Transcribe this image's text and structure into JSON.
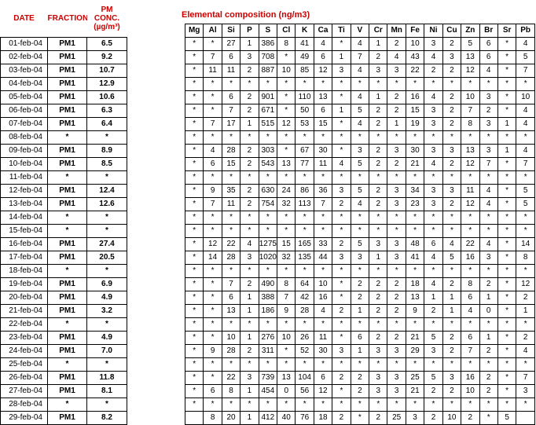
{
  "headers": {
    "date": "DATE",
    "fraction": "FRACTION",
    "pm_conc_line1": "PM",
    "pm_conc_line2": "CONC.",
    "pm_conc_unit": "(µg/m³)",
    "composition_title": "Elemental composition (ng/m3)"
  },
  "elements": [
    "Mg",
    "Al",
    "Si",
    "P",
    "S",
    "Cl",
    "K",
    "Ca",
    "Ti",
    "V",
    "Cr",
    "Mn",
    "Fe",
    "Ni",
    "Cu",
    "Zn",
    "Br",
    "Sr",
    "Pb"
  ],
  "rows": [
    {
      "date": "01-feb-04",
      "fraction": "PM1",
      "conc": "6.5",
      "values": [
        "*",
        "*",
        "27",
        "1",
        "386",
        "8",
        "41",
        "4",
        "*",
        "4",
        "1",
        "2",
        "10",
        "3",
        "2",
        "5",
        "6",
        "*",
        "4"
      ]
    },
    {
      "date": "02-feb-04",
      "fraction": "PM1",
      "conc": "9.2",
      "values": [
        "*",
        "7",
        "6",
        "3",
        "708",
        "*",
        "49",
        "6",
        "1",
        "7",
        "2",
        "4",
        "43",
        "4",
        "3",
        "13",
        "6",
        "*",
        "5"
      ]
    },
    {
      "date": "03-feb-04",
      "fraction": "PM1",
      "conc": "10.7",
      "values": [
        "*",
        "11",
        "11",
        "2",
        "887",
        "10",
        "85",
        "12",
        "3",
        "4",
        "3",
        "3",
        "22",
        "2",
        "2",
        "12",
        "4",
        "*",
        "7"
      ]
    },
    {
      "date": "04-feb-04",
      "fraction": "PM1",
      "conc": "12.9",
      "values": [
        "*",
        "*",
        "*",
        "*",
        "*",
        "*",
        "*",
        "*",
        "*",
        "*",
        "*",
        "*",
        "*",
        "*",
        "*",
        "*",
        "*",
        "*",
        "*"
      ]
    },
    {
      "date": "05-feb-04",
      "fraction": "PM1",
      "conc": "10.6",
      "values": [
        "*",
        "*",
        "6",
        "2",
        "901",
        "*",
        "110",
        "13",
        "*",
        "4",
        "1",
        "2",
        "16",
        "4",
        "2",
        "10",
        "3",
        "*",
        "10"
      ]
    },
    {
      "date": "06-feb-04",
      "fraction": "PM1",
      "conc": "6.3",
      "values": [
        "*",
        "*",
        "7",
        "2",
        "671",
        "*",
        "50",
        "6",
        "1",
        "5",
        "2",
        "2",
        "15",
        "3",
        "2",
        "7",
        "2",
        "*",
        "4"
      ]
    },
    {
      "date": "07-feb-04",
      "fraction": "PM1",
      "conc": "6.4",
      "values": [
        "*",
        "7",
        "17",
        "1",
        "515",
        "12",
        "53",
        "15",
        "*",
        "4",
        "2",
        "1",
        "19",
        "3",
        "2",
        "8",
        "3",
        "1",
        "4"
      ]
    },
    {
      "date": "08-feb-04",
      "fraction": "*",
      "conc": "*",
      "values": [
        "*",
        "*",
        "*",
        "*",
        "*",
        "*",
        "*",
        "*",
        "*",
        "*",
        "*",
        "*",
        "*",
        "*",
        "*",
        "*",
        "*",
        "*",
        "*"
      ]
    },
    {
      "date": "09-feb-04",
      "fraction": "PM1",
      "conc": "8.9",
      "values": [
        "*",
        "4",
        "28",
        "2",
        "303",
        "*",
        "67",
        "30",
        "*",
        "3",
        "2",
        "3",
        "30",
        "3",
        "3",
        "13",
        "3",
        "1",
        "4"
      ]
    },
    {
      "date": "10-feb-04",
      "fraction": "PM1",
      "conc": "8.5",
      "values": [
        "*",
        "6",
        "15",
        "2",
        "543",
        "13",
        "77",
        "11",
        "4",
        "5",
        "2",
        "2",
        "21",
        "4",
        "2",
        "12",
        "7",
        "*",
        "7"
      ]
    },
    {
      "date": "11-feb-04",
      "fraction": "*",
      "conc": "*",
      "values": [
        "*",
        "*",
        "*",
        "*",
        "*",
        "*",
        "*",
        "*",
        "*",
        "*",
        "*",
        "*",
        "*",
        "*",
        "*",
        "*",
        "*",
        "*",
        "*"
      ]
    },
    {
      "date": "12-feb-04",
      "fraction": "PM1",
      "conc": "12.4",
      "values": [
        "*",
        "9",
        "35",
        "2",
        "630",
        "24",
        "86",
        "36",
        "3",
        "5",
        "2",
        "3",
        "34",
        "3",
        "3",
        "11",
        "4",
        "*",
        "5"
      ]
    },
    {
      "date": "13-feb-04",
      "fraction": "PM1",
      "conc": "12.6",
      "values": [
        "*",
        "7",
        "11",
        "2",
        "754",
        "32",
        "113",
        "7",
        "2",
        "4",
        "2",
        "3",
        "23",
        "3",
        "2",
        "12",
        "4",
        "*",
        "5"
      ]
    },
    {
      "date": "14-feb-04",
      "fraction": "*",
      "conc": "*",
      "values": [
        "*",
        "*",
        "*",
        "*",
        "*",
        "*",
        "*",
        "*",
        "*",
        "*",
        "*",
        "*",
        "*",
        "*",
        "*",
        "*",
        "*",
        "*",
        "*"
      ]
    },
    {
      "date": "15-feb-04",
      "fraction": "*",
      "conc": "*",
      "values": [
        "*",
        "*",
        "*",
        "*",
        "*",
        "*",
        "*",
        "*",
        "*",
        "*",
        "*",
        "*",
        "*",
        "*",
        "*",
        "*",
        "*",
        "*",
        "*"
      ]
    },
    {
      "date": "16-feb-04",
      "fraction": "PM1",
      "conc": "27.4",
      "values": [
        "*",
        "12",
        "22",
        "4",
        "1275",
        "15",
        "165",
        "33",
        "2",
        "5",
        "3",
        "3",
        "48",
        "6",
        "4",
        "22",
        "4",
        "*",
        "14"
      ]
    },
    {
      "date": "17-feb-04",
      "fraction": "PM1",
      "conc": "20.5",
      "values": [
        "*",
        "14",
        "28",
        "3",
        "1020",
        "32",
        "135",
        "44",
        "3",
        "3",
        "1",
        "3",
        "41",
        "4",
        "5",
        "16",
        "3",
        "*",
        "8"
      ]
    },
    {
      "date": "18-feb-04",
      "fraction": "*",
      "conc": "*",
      "values": [
        "*",
        "*",
        "*",
        "*",
        "*",
        "*",
        "*",
        "*",
        "*",
        "*",
        "*",
        "*",
        "*",
        "*",
        "*",
        "*",
        "*",
        "*",
        "*"
      ]
    },
    {
      "date": "19-feb-04",
      "fraction": "PM1",
      "conc": "6.9",
      "values": [
        "*",
        "*",
        "7",
        "2",
        "490",
        "8",
        "64",
        "10",
        "*",
        "2",
        "2",
        "2",
        "18",
        "4",
        "2",
        "8",
        "2",
        "*",
        "12"
      ]
    },
    {
      "date": "20-feb-04",
      "fraction": "PM1",
      "conc": "4.9",
      "values": [
        "*",
        "*",
        "6",
        "1",
        "388",
        "7",
        "42",
        "16",
        "*",
        "2",
        "2",
        "2",
        "13",
        "1",
        "1",
        "6",
        "1",
        "*",
        "2"
      ]
    },
    {
      "date": "21-feb-04",
      "fraction": "PM1",
      "conc": "3.2",
      "values": [
        "*",
        "*",
        "13",
        "1",
        "186",
        "9",
        "28",
        "4",
        "2",
        "1",
        "2",
        "2",
        "9",
        "2",
        "1",
        "4",
        "0",
        "*",
        "1"
      ]
    },
    {
      "date": "22-feb-04",
      "fraction": "*",
      "conc": "*",
      "values": [
        "*",
        "*",
        "*",
        "*",
        "*",
        "*",
        "*",
        "*",
        "*",
        "*",
        "*",
        "*",
        "*",
        "*",
        "*",
        "*",
        "*",
        "*",
        "*"
      ]
    },
    {
      "date": "23-feb-04",
      "fraction": "PM1",
      "conc": "4.9",
      "values": [
        "*",
        "*",
        "10",
        "1",
        "276",
        "10",
        "26",
        "11",
        "*",
        "6",
        "2",
        "2",
        "21",
        "5",
        "2",
        "6",
        "1",
        "*",
        "2"
      ]
    },
    {
      "date": "24-feb-04",
      "fraction": "PM1",
      "conc": "7.0",
      "values": [
        "*",
        "9",
        "28",
        "2",
        "311",
        "*",
        "52",
        "30",
        "3",
        "1",
        "3",
        "3",
        "29",
        "3",
        "2",
        "7",
        "2",
        "*",
        "4"
      ]
    },
    {
      "date": "25-feb-04",
      "fraction": "*",
      "conc": "*",
      "values": [
        "*",
        "*",
        "*",
        "*",
        "*",
        "*",
        "*",
        "*",
        "*",
        "*",
        "*",
        "*",
        "*",
        "*",
        "*",
        "*",
        "*",
        "*",
        "*"
      ]
    },
    {
      "date": "26-feb-04",
      "fraction": "PM1",
      "conc": "11.8",
      "values": [
        "*",
        "*",
        "22",
        "3",
        "739",
        "13",
        "104",
        "6",
        "2",
        "2",
        "3",
        "3",
        "25",
        "5",
        "3",
        "16",
        "2",
        "*",
        "7"
      ]
    },
    {
      "date": "27-feb-04",
      "fraction": "PM1",
      "conc": "8.1",
      "values": [
        "*",
        "6",
        "8",
        "1",
        "454",
        "0",
        "56",
        "12",
        "*",
        "2",
        "3",
        "3",
        "21",
        "2",
        "2",
        "10",
        "2",
        "*",
        "3"
      ]
    },
    {
      "date": "28-feb-04",
      "fraction": "*",
      "conc": "*",
      "values": [
        "*",
        "*",
        "*",
        "*",
        "*",
        "*",
        "*",
        "*",
        "*",
        "*",
        "*",
        "*",
        "*",
        "*",
        "*",
        "*",
        "*",
        "*",
        "*"
      ]
    },
    {
      "date": "29-feb-04",
      "fraction": "PM1",
      "conc": "8.2",
      "values": [
        "",
        "8",
        "20",
        "1",
        "412",
        "40",
        "76",
        "18",
        "2",
        "*",
        "2",
        "25",
        "3",
        "2",
        "10",
        "2",
        "*",
        "5",
        ""
      ]
    }
  ]
}
